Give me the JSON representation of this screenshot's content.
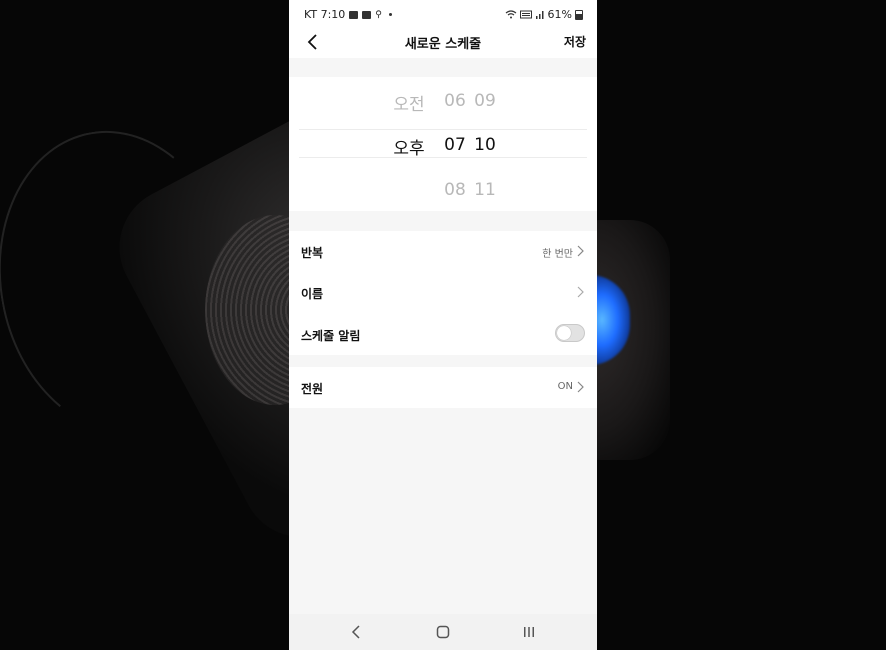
{
  "status_bar": {
    "carrier_time": "KT 7:10",
    "battery": "61%",
    "signal_label": "ull"
  },
  "header": {
    "title": "새로운 스케줄",
    "save_label": "저장"
  },
  "time_picker": {
    "ampm": {
      "above": "오전",
      "selected": "오후",
      "below": ""
    },
    "hour": {
      "above": "06",
      "selected": "07",
      "below": "08"
    },
    "minute": {
      "above": "09",
      "selected": "10",
      "below": "11"
    }
  },
  "settings": {
    "repeat": {
      "label": "반복",
      "value": "한 번만"
    },
    "name": {
      "label": "이름",
      "value": ""
    },
    "notification": {
      "label": "스케줄 알림",
      "enabled": false
    }
  },
  "power": {
    "label": "전원",
    "value": "ON"
  },
  "icons": [
    "back-icon",
    "chevron-right-icon",
    "nav-back-icon",
    "nav-home-icon",
    "nav-recents-icon",
    "wifi-icon",
    "signal-icon",
    "battery-icon"
  ],
  "colors": {
    "background": "#f6f6f6",
    "card": "#ffffff",
    "text": "#111111",
    "dim_text": "#b8b8b8",
    "toggle_off": "#e2e2e2"
  }
}
